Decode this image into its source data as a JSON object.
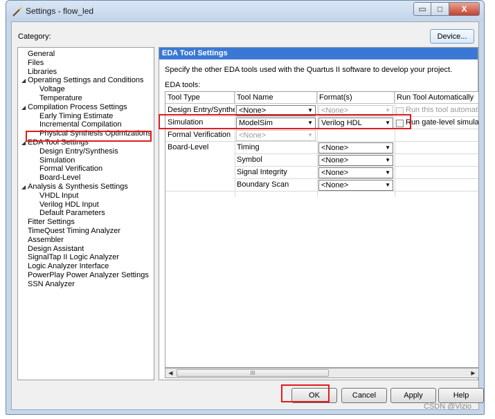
{
  "window": {
    "title": "Settings - flow_led",
    "icon": "settings-wand-icon"
  },
  "caption_buttons": {
    "minimize": "▭",
    "maximize": "□",
    "close": "X"
  },
  "category_label": "Category:",
  "device_button": "Device...",
  "tree": [
    {
      "label": "General",
      "level": 1,
      "expanded": null
    },
    {
      "label": "Files",
      "level": 1,
      "expanded": null
    },
    {
      "label": "Libraries",
      "level": 1,
      "expanded": null
    },
    {
      "label": "Operating Settings and Conditions",
      "level": 1,
      "expanded": true
    },
    {
      "label": "Voltage",
      "level": 2,
      "expanded": null
    },
    {
      "label": "Temperature",
      "level": 2,
      "expanded": null
    },
    {
      "label": "Compilation Process Settings",
      "level": 1,
      "expanded": true
    },
    {
      "label": "Early Timing Estimate",
      "level": 2,
      "expanded": null
    },
    {
      "label": "Incremental Compilation",
      "level": 2,
      "expanded": null
    },
    {
      "label": "Physical Synthesis Optimizations",
      "level": 2,
      "expanded": null
    },
    {
      "label": "EDA Tool Settings",
      "level": 1,
      "expanded": true,
      "selected": true
    },
    {
      "label": "Design Entry/Synthesis",
      "level": 2,
      "expanded": null
    },
    {
      "label": "Simulation",
      "level": 2,
      "expanded": null
    },
    {
      "label": "Formal Verification",
      "level": 2,
      "expanded": null
    },
    {
      "label": "Board-Level",
      "level": 2,
      "expanded": null
    },
    {
      "label": "Analysis & Synthesis Settings",
      "level": 1,
      "expanded": true
    },
    {
      "label": "VHDL Input",
      "level": 2,
      "expanded": null
    },
    {
      "label": "Verilog HDL Input",
      "level": 2,
      "expanded": null
    },
    {
      "label": "Default Parameters",
      "level": 2,
      "expanded": null
    },
    {
      "label": "Fitter Settings",
      "level": 1,
      "expanded": null
    },
    {
      "label": "TimeQuest Timing Analyzer",
      "level": 1,
      "expanded": null
    },
    {
      "label": "Assembler",
      "level": 1,
      "expanded": null
    },
    {
      "label": "Design Assistant",
      "level": 1,
      "expanded": null
    },
    {
      "label": "SignalTap II Logic Analyzer",
      "level": 1,
      "expanded": null
    },
    {
      "label": "Logic Analyzer Interface",
      "level": 1,
      "expanded": null
    },
    {
      "label": "PowerPlay Power Analyzer Settings",
      "level": 1,
      "expanded": null
    },
    {
      "label": "SSN Analyzer",
      "level": 1,
      "expanded": null
    }
  ],
  "panel": {
    "header": "EDA Tool Settings",
    "description": "Specify the other EDA tools used with the Quartus II software to develop your project.",
    "eda_tools_label": "EDA tools:",
    "columns": [
      "Tool Type",
      "Tool Name",
      "Format(s)",
      "Run Tool Automatically"
    ],
    "rows": [
      {
        "tool_type": "Design Entry/Synthesis",
        "tool_name": "<None>",
        "format": "<None>",
        "format_disabled": true,
        "run_label": "Run this tool automatic",
        "run_disabled": true
      },
      {
        "tool_type": "Simulation",
        "tool_name": "ModelSim",
        "format": "Verilog HDL",
        "format_disabled": false,
        "run_label": "Run gate-level simulati",
        "run_disabled": false
      },
      {
        "tool_type": "Formal Verification",
        "tool_name": "<None>",
        "tool_name_disabled": true
      },
      {
        "tool_type": "Board-Level",
        "sub": [
          {
            "name": "Timing",
            "format": "<None>"
          },
          {
            "name": "Symbol",
            "format": "<None>"
          },
          {
            "name": "Signal Integrity",
            "format": "<None>"
          },
          {
            "name": "Boundary Scan",
            "format": "<None>"
          }
        ]
      }
    ],
    "hscroll_grip": "III"
  },
  "buttons": {
    "ok": "OK",
    "cancel": "Cancel",
    "apply": "Apply",
    "help": "Help"
  },
  "watermark": "CSDN @Vizio",
  "colors": {
    "header_blue": "#3a78d4",
    "highlight_red": "#e01b1b"
  }
}
